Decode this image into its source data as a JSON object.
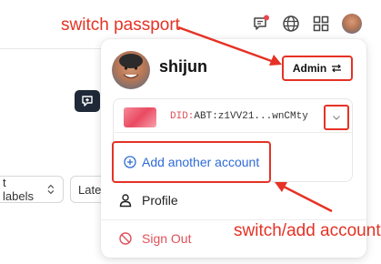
{
  "annotations": {
    "switch_passport": "switch passport",
    "switch_add_account": "switch/add account"
  },
  "header": {
    "icons": [
      "notification-icon",
      "globe-icon",
      "apps-grid-icon"
    ],
    "notification_dot_color": "#e5484d"
  },
  "background": {
    "select_left_value": "t labels",
    "select_right_value": "Late"
  },
  "account_menu": {
    "username": "shijun",
    "role_label": "Admin",
    "did_prefix": "DID:",
    "did_value": "ABT:z1VV21...wnCMty",
    "add_account_label": "Add another account",
    "profile_label": "Profile",
    "sign_out_label": "Sign Out"
  },
  "colors": {
    "annotation_red": "#e53225",
    "link_blue": "#2f6bd6",
    "sign_out_red": "#e0505a"
  }
}
